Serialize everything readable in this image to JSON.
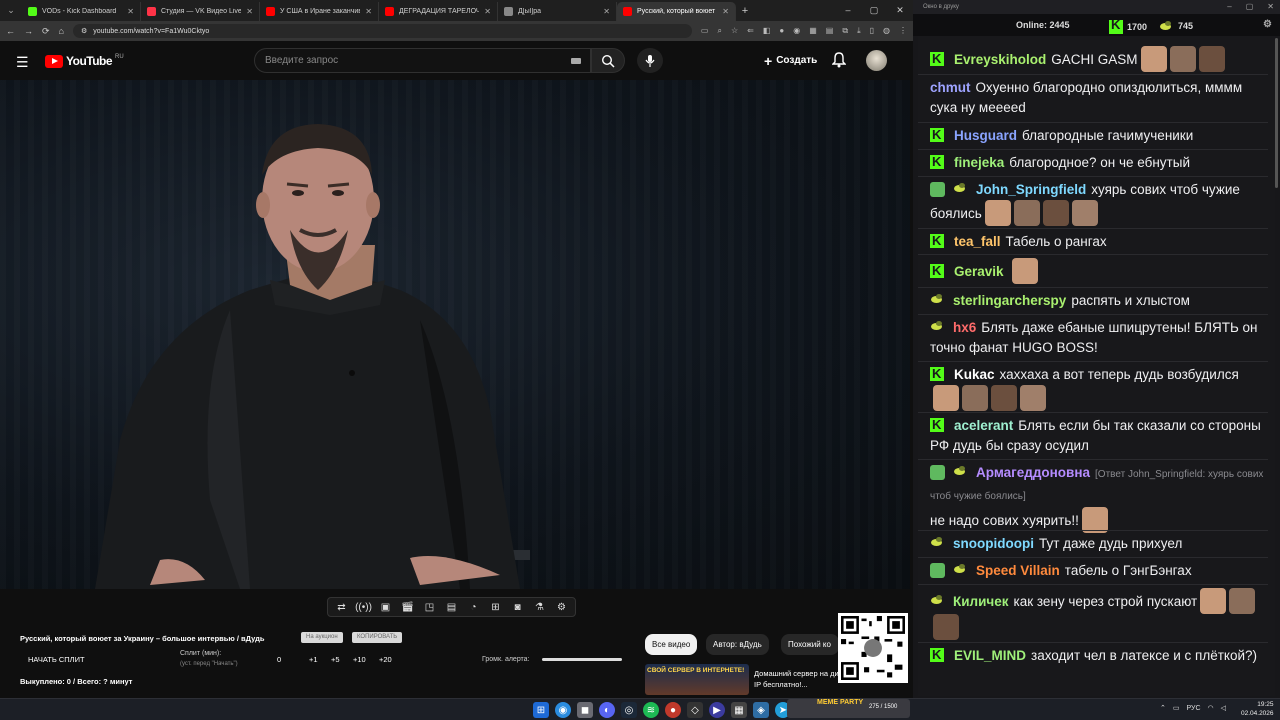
{
  "browser": {
    "tabs": [
      {
        "title": "VODs - Kick Dashboard",
        "color": "#53fc18"
      },
      {
        "title": "Студия — VK Видео Live",
        "color": "#ff3347"
      },
      {
        "title": "У США в Иране заканчиваются",
        "color": "#ff0000"
      },
      {
        "title": "ДЕГРАДАЦИЯ ТАРЕЛОЧНИЦ",
        "color": "#ff0000"
      },
      {
        "title": "Д[ыl]ра",
        "color": "#888888"
      },
      {
        "title": "Русский, который воюет з",
        "color": "#ff0000",
        "active": true
      }
    ],
    "url": "youtube.com/watch?v=Fa1Wu0Cktyo"
  },
  "youtube": {
    "logo_text": "YouTube",
    "logo_region": "RU",
    "search_placeholder": "Введите запрос",
    "create_label": "Создать"
  },
  "video_panel": {
    "title": "Русский, который воюет за Украину – большое интервью / вДудь",
    "pill1": "На аукцион",
    "pill2": "КОПИРОВАТЬ",
    "split_button": "НАЧАТЬ СПЛИТ",
    "split_label": "Сплит (мин):",
    "split_sub": "(уст. перед \"Начать\")",
    "split_values": [
      "0",
      "+1",
      "+5",
      "+10",
      "+20"
    ],
    "alert_label": "Громк. алерта:",
    "bought": "Выкуплено: 0 / Всего: ? минут",
    "chips": [
      "Все видео",
      "Автор: вДудь",
      "Похожий ко"
    ],
    "rec_thumb_text": "СВОЙ СЕРВЕР В ИНТЕРНЕТЕ!",
    "rec_title": "Домашний сервер на динамическом IP бесплатно!..."
  },
  "chat": {
    "window_title": "Окно в друку",
    "online_label": "Online:",
    "online_count": "2445",
    "kick_count": "1700",
    "twitch_count": "745",
    "messages": [
      {
        "badge": "kick",
        "user": "Evreyskiholod",
        "color": "#a9f06f",
        "text": "GACHI GASM",
        "emotes": 3
      },
      {
        "badge": "none",
        "user": "chmut",
        "color": "#9ea3ff",
        "text": "Охуенно благородно опиздюлиться, мммм сука ну мееееd"
      },
      {
        "badge": "kick",
        "user": "Husguard",
        "color": "#8aa4ff",
        "text": "благородные гачимученики"
      },
      {
        "badge": "kick",
        "user": "finejeka",
        "color": "#9ff07a",
        "text": "благородное? он че ебнутый"
      },
      {
        "badge": "twitch-pencil",
        "user": "John_Springfield",
        "color": "#7fd9ff",
        "text": "хуярь сових чтоб чужие боялись",
        "emotes": 4
      },
      {
        "badge": "kick",
        "user": "tea_fall",
        "color": "#ffc56b",
        "text": "Табель о рангах"
      },
      {
        "badge": "kick",
        "user": "Geravik",
        "color": "#a9f06f",
        "text": "",
        "emotes": 1
      },
      {
        "badge": "twitch",
        "user": "sterlingarcherspy",
        "color": "#a9f06f",
        "text": "распять и хлыстом"
      },
      {
        "badge": "twitch",
        "user": "hx6",
        "color": "#ff6b6b",
        "text": "Блять даже ебаные шпицрутены! БЛЯТЬ он точно фанат HUGO BOSS!"
      },
      {
        "badge": "kick",
        "user": "Kukac",
        "color": "#ffffff",
        "text": "хаххаха а вот теперь дудь возбудился",
        "emotes": 4
      },
      {
        "badge": "kick",
        "user": "acelerant",
        "color": "#9ff0d0",
        "text": "Блять если бы так сказали со стороны РФ дудь бы сразу осудил"
      },
      {
        "badge": "shield-twitch",
        "user": "Армагеддоновна",
        "color": "#b58cff",
        "reply": "[Ответ John_Springfield: хуярь сових чтоб чужие боялись]",
        "text": "не надо сових хуярить!!",
        "emotes": 1
      },
      {
        "badge": "twitch",
        "user": "snoopidoopi",
        "color": "#7fd9ff",
        "text": "Тут даже дудь прихуел"
      },
      {
        "badge": "shield-twitch",
        "user": "Speed Villain",
        "color": "#ff8a3d",
        "text": "табель о ГэнгБэнгах"
      },
      {
        "badge": "twitch",
        "user": "Киличек",
        "color": "#9ff07a",
        "text": "как зену через строй пускают",
        "emotes": 3
      },
      {
        "badge": "kick",
        "user": "EVIL_MIND",
        "color": "#9ff07a",
        "text": "заходит чел в латексе и с плёткой?)"
      }
    ]
  },
  "taskbar": {
    "app_label": "MEME PARTY",
    "app_counter": "275 / 1500",
    "lang": "РУС",
    "time": "19:25",
    "date": "02.04.2026"
  }
}
